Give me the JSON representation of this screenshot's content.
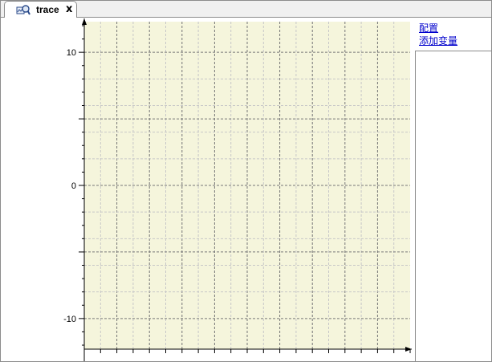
{
  "tab": {
    "label": "trace",
    "close": "x",
    "icon": "trace-scope-icon"
  },
  "side": {
    "config_link": "配置",
    "add_variable_link": "添加变量"
  },
  "chart_data": {
    "type": "line",
    "series": [],
    "ylim": [
      -12.3,
      12.3
    ],
    "yticks": [
      -10,
      0,
      10
    ],
    "grid": true,
    "plot_background": "#f5f5dc"
  }
}
